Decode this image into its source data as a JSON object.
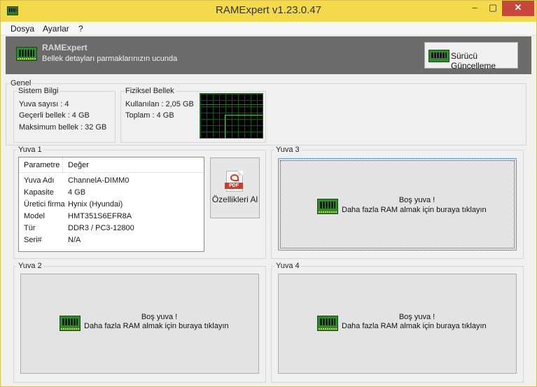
{
  "window": {
    "title": "RAMExpert v1.23.0.47",
    "min": "–",
    "max": "▢",
    "close": "✕"
  },
  "menu": [
    "Dosya",
    "Ayarlar",
    "?"
  ],
  "header": {
    "title": "RAMExpert",
    "subtitle": "Bellek detayları parmaklarınızın ucunda",
    "driver_button": "Sürücü Güncelleme"
  },
  "genel": {
    "legend": "Genel",
    "sistem": {
      "legend": "Sistem Bilgi",
      "lines": [
        "Yuva sayısı : 4",
        "Geçerli bellek : 4 GB",
        "Maksimum bellek : 32 GB"
      ]
    },
    "fiziksel": {
      "legend": "Fiziksel Bellek",
      "lines": [
        "Kullanılan : 2,05 GB",
        "Toplam : 4 GB"
      ]
    }
  },
  "slot1": {
    "legend": "Yuva 1",
    "headers": [
      "Parametre",
      "Değer"
    ],
    "rows": [
      [
        "Yuva Adı",
        "ChannelA-DIMM0"
      ],
      [
        "Kapasite",
        "4 GB"
      ],
      [
        "Üretici firma",
        "Hynix (Hyundai)"
      ],
      [
        "Model",
        "HMT351S6EFR8A"
      ],
      [
        "Tür",
        "DDR3 / PC3-12800"
      ],
      [
        "Seri#",
        "N/A"
      ]
    ],
    "pdf_button": "Özellikleri Al",
    "pdf_tag": "PDF"
  },
  "slot2": {
    "legend": "Yuva 2",
    "line1": "Boş yuva !",
    "line2": "Daha fazla RAM almak için buraya tıklayın"
  },
  "slot3": {
    "legend": "Yuva 3",
    "line1": "Boş yuva !",
    "line2": "Daha fazla RAM almak için buraya tıklayın"
  },
  "slot4": {
    "legend": "Yuva 4",
    "line1": "Boş yuva !",
    "line2": "Daha fazla RAM almak için buraya tıklayın"
  },
  "colors": {
    "titlebar": "#f4d94a",
    "header_band": "#6b6b6b",
    "close_button": "#c7473a",
    "graph_green": "#3cd23c",
    "graph_red": "#c4322e"
  }
}
